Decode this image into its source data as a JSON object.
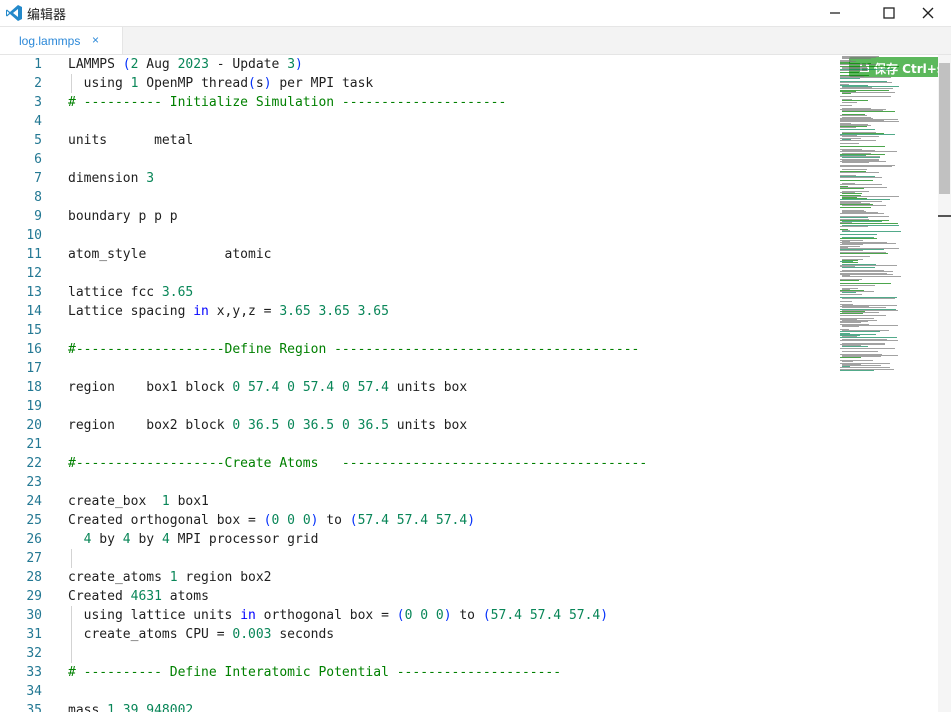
{
  "window": {
    "title": "编辑器",
    "app_icon": "vscode-icon",
    "controls": [
      "minimize-icon",
      "maximize-icon",
      "close-icon"
    ]
  },
  "tab": {
    "label": "log.lammps",
    "close_glyph": "×"
  },
  "toolbar": {
    "save_label": "保存 Ctrl+s",
    "save_icon": "save-icon",
    "save_color": "#5cb85c"
  },
  "colors": {
    "number": "#098658",
    "keyword": "#0000ff",
    "comment": "#008000",
    "paren": "#0431fa",
    "line_number": "#237893"
  },
  "editor": {
    "lines": [
      {
        "n": "1",
        "t": [
          [
            "LAMMPS "
          ],
          [
            "(",
            "paren"
          ],
          [
            "2",
            "num"
          ],
          [
            " Aug "
          ],
          [
            "2023",
            "num"
          ],
          [
            " - Update "
          ],
          [
            "3",
            "num"
          ],
          [
            ")",
            "paren"
          ]
        ]
      },
      {
        "n": "2",
        "t": [
          [
            "  using "
          ],
          [
            "1",
            "num"
          ],
          [
            " OpenMP thread"
          ],
          [
            "(",
            "paren"
          ],
          [
            "s"
          ],
          [
            ")",
            "paren"
          ],
          [
            " per MPI task"
          ]
        ]
      },
      {
        "n": "3",
        "t": [
          [
            "# ---------- Initialize Simulation ---------------------",
            "cm"
          ]
        ]
      },
      {
        "n": "4",
        "t": []
      },
      {
        "n": "5",
        "t": [
          [
            "units      metal"
          ]
        ]
      },
      {
        "n": "6",
        "t": []
      },
      {
        "n": "7",
        "t": [
          [
            "dimension "
          ],
          [
            "3",
            "num"
          ]
        ]
      },
      {
        "n": "8",
        "t": []
      },
      {
        "n": "9",
        "t": [
          [
            "boundary p p p"
          ]
        ]
      },
      {
        "n": "10",
        "t": []
      },
      {
        "n": "11",
        "t": [
          [
            "atom_style          atomic"
          ]
        ]
      },
      {
        "n": "12",
        "t": []
      },
      {
        "n": "13",
        "t": [
          [
            "lattice fcc "
          ],
          [
            "3.65",
            "num"
          ]
        ]
      },
      {
        "n": "14",
        "t": [
          [
            "Lattice spacing "
          ],
          [
            "in",
            "kw"
          ],
          [
            " x,y,z = "
          ],
          [
            "3.65",
            "num"
          ],
          [
            " "
          ],
          [
            "3.65",
            "num"
          ],
          [
            " "
          ],
          [
            "3.65",
            "num"
          ]
        ]
      },
      {
        "n": "15",
        "t": []
      },
      {
        "n": "16",
        "t": [
          [
            "#-------------------Define Region ---------------------------------------",
            "cm"
          ]
        ]
      },
      {
        "n": "17",
        "t": []
      },
      {
        "n": "18",
        "t": [
          [
            "region    box1 block "
          ],
          [
            "0",
            "num"
          ],
          [
            " "
          ],
          [
            "57.4",
            "num"
          ],
          [
            " "
          ],
          [
            "0",
            "num"
          ],
          [
            " "
          ],
          [
            "57.4",
            "num"
          ],
          [
            " "
          ],
          [
            "0",
            "num"
          ],
          [
            " "
          ],
          [
            "57.4",
            "num"
          ],
          [
            " units box"
          ]
        ]
      },
      {
        "n": "19",
        "t": []
      },
      {
        "n": "20",
        "t": [
          [
            "region    box2 block "
          ],
          [
            "0",
            "num"
          ],
          [
            " "
          ],
          [
            "36.5",
            "num"
          ],
          [
            " "
          ],
          [
            "0",
            "num"
          ],
          [
            " "
          ],
          [
            "36.5",
            "num"
          ],
          [
            " "
          ],
          [
            "0",
            "num"
          ],
          [
            " "
          ],
          [
            "36.5",
            "num"
          ],
          [
            " units box"
          ]
        ]
      },
      {
        "n": "21",
        "t": []
      },
      {
        "n": "22",
        "t": [
          [
            "#-------------------Create Atoms   ---------------------------------------",
            "cm"
          ]
        ]
      },
      {
        "n": "23",
        "t": []
      },
      {
        "n": "24",
        "t": [
          [
            "create_box  "
          ],
          [
            "1",
            "num"
          ],
          [
            " box1"
          ]
        ]
      },
      {
        "n": "25",
        "t": [
          [
            "Created orthogonal box = "
          ],
          [
            "(",
            "paren"
          ],
          [
            "0",
            "num"
          ],
          [
            " "
          ],
          [
            "0",
            "num"
          ],
          [
            " "
          ],
          [
            "0",
            "num"
          ],
          [
            ")",
            "paren"
          ],
          [
            " to "
          ],
          [
            "(",
            "paren"
          ],
          [
            "57.4",
            "num"
          ],
          [
            " "
          ],
          [
            "57.4",
            "num"
          ],
          [
            " "
          ],
          [
            "57.4",
            "num"
          ],
          [
            ")",
            "paren"
          ]
        ]
      },
      {
        "n": "26",
        "t": [
          [
            "  "
          ],
          [
            "4",
            "num"
          ],
          [
            " by "
          ],
          [
            "4",
            "num"
          ],
          [
            " by "
          ],
          [
            "4",
            "num"
          ],
          [
            " MPI processor grid"
          ]
        ]
      },
      {
        "n": "27",
        "t": []
      },
      {
        "n": "28",
        "t": [
          [
            "create_atoms "
          ],
          [
            "1",
            "num"
          ],
          [
            " region box2"
          ]
        ]
      },
      {
        "n": "29",
        "t": [
          [
            "Created "
          ],
          [
            "4631",
            "num"
          ],
          [
            " atoms"
          ]
        ]
      },
      {
        "n": "30",
        "t": [
          [
            "  using lattice units "
          ],
          [
            "in",
            "kw"
          ],
          [
            " orthogonal box = "
          ],
          [
            "(",
            "paren"
          ],
          [
            "0",
            "num"
          ],
          [
            " "
          ],
          [
            "0",
            "num"
          ],
          [
            " "
          ],
          [
            "0",
            "num"
          ],
          [
            ")",
            "paren"
          ],
          [
            " to "
          ],
          [
            "(",
            "paren"
          ],
          [
            "57.4",
            "num"
          ],
          [
            " "
          ],
          [
            "57.4",
            "num"
          ],
          [
            " "
          ],
          [
            "57.4",
            "num"
          ],
          [
            ")",
            "paren"
          ]
        ]
      },
      {
        "n": "31",
        "t": [
          [
            "  create_atoms CPU = "
          ],
          [
            "0.003",
            "num"
          ],
          [
            " seconds"
          ]
        ]
      },
      {
        "n": "32",
        "t": []
      },
      {
        "n": "33",
        "t": [
          [
            "# ---------- Define Interatomic Potential ---------------------",
            "cm"
          ]
        ]
      },
      {
        "n": "34",
        "t": []
      },
      {
        "n": "35",
        "t": [
          [
            "mass "
          ],
          [
            "1",
            "num"
          ],
          [
            " "
          ],
          [
            "39.948002",
            "num"
          ]
        ]
      }
    ]
  }
}
